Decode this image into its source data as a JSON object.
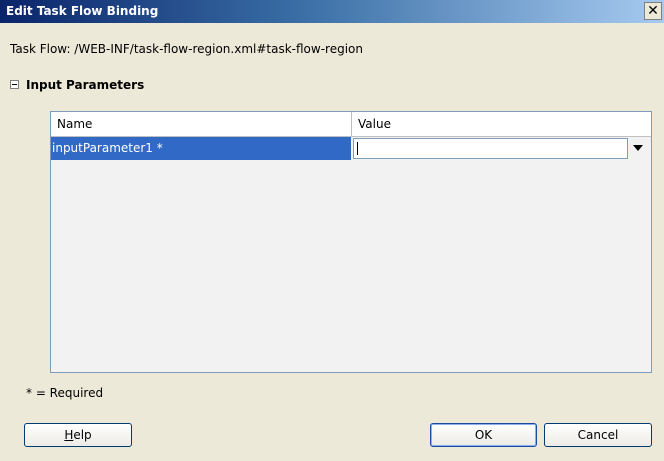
{
  "dialog": {
    "title": "Edit Task Flow Binding",
    "close_symbol": "✕"
  },
  "task_flow": {
    "label": "Task Flow: /WEB-INF/task-flow-region.xml#task-flow-region"
  },
  "input_parameters": {
    "header": "Input Parameters",
    "columns": [
      "Name",
      "Value"
    ],
    "rows": [
      {
        "name": "inputParameter1 *",
        "value": ""
      }
    ]
  },
  "required_note": "* = Required",
  "buttons": {
    "help_first": "H",
    "help_rest": "elp",
    "ok": "OK",
    "cancel": "Cancel"
  }
}
